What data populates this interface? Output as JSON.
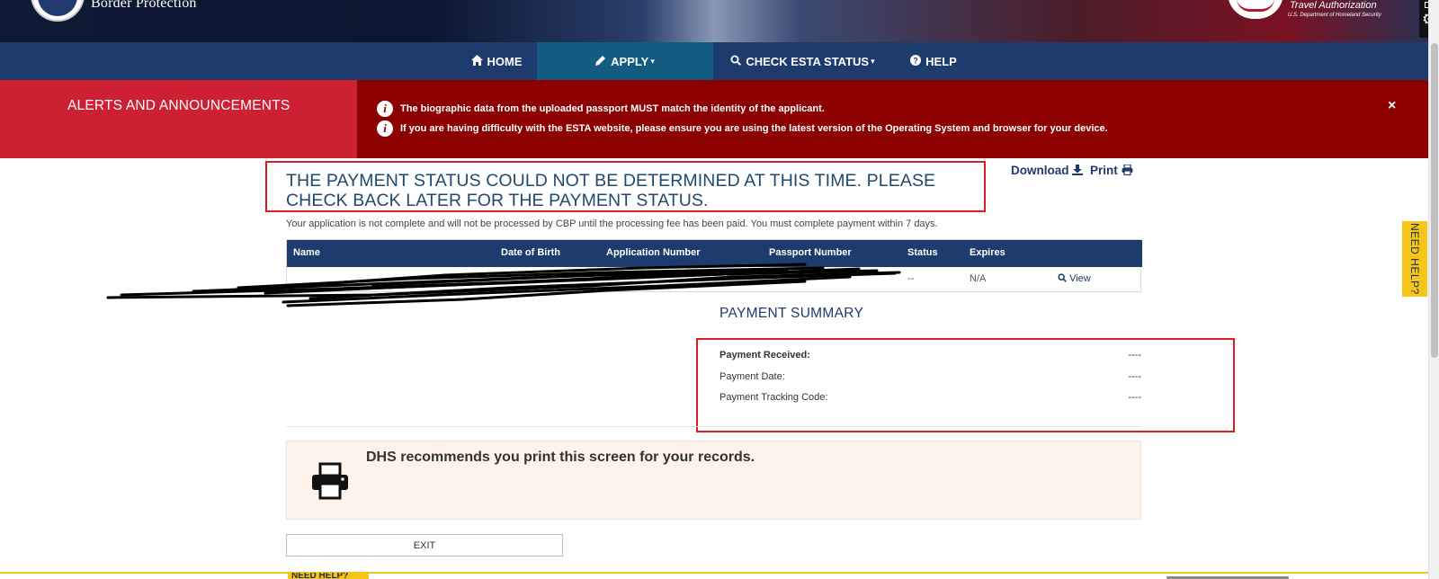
{
  "header": {
    "agency_name": "Border Protection",
    "esta_logo": {
      "tagline": "Travel Authorization",
      "subline": "U.S. Department of Homeland Security"
    }
  },
  "nav": {
    "items": [
      {
        "label": "HOME",
        "icon": "home-icon"
      },
      {
        "label": "APPLY",
        "icon": "pencil-icon",
        "caret": "▾",
        "active": true
      },
      {
        "label": "CHECK ESTA STATUS",
        "icon": "search-icon",
        "caret": "▾"
      },
      {
        "label": "HELP",
        "icon": "question-circle-icon"
      }
    ]
  },
  "alerts": {
    "title": "ALERTS AND ANNOUNCEMENTS",
    "messages": [
      "The biographic data from the uploaded passport MUST match the identity of the applicant.",
      "If you are having difficulty with the ESTA website, please ensure you are using the latest version of the Operating System and browser for your device."
    ],
    "close": "×"
  },
  "main": {
    "status_heading": "THE PAYMENT STATUS COULD NOT BE DETERMINED AT THIS TIME. PLEASE CHECK BACK LATER FOR THE PAYMENT STATUS.",
    "download_label": "Download",
    "print_label": "Print",
    "note": "Your application is not complete and will not be processed by CBP until the processing fee has been paid. You must complete payment within 7 days.",
    "table": {
      "headers": [
        "Name",
        "Date of Birth",
        "Application Number",
        "Passport Number",
        "Status",
        "Expires"
      ],
      "row": {
        "status": "--",
        "expires": "N/A",
        "action": "View"
      }
    },
    "payment_summary": {
      "title": "PAYMENT SUMMARY",
      "rows": [
        {
          "label": "Payment Received:",
          "value": "----"
        },
        {
          "label": "Payment Date:",
          "value": "----"
        },
        {
          "label": "Payment Tracking Code:",
          "value": "----"
        }
      ]
    },
    "recommendation": "DHS recommends you print this screen for your records.",
    "exit_label": "EXIT"
  },
  "help": {
    "side_label": "NEED HELP?",
    "bottom_label": "NEED HELP?"
  },
  "colors": {
    "nav_bg": "#1e3b6e",
    "nav_active": "#145b82",
    "alert_dark": "#8c0000",
    "alert_light": "#cd2033",
    "heading_text": "#1f4a6e",
    "highlight_border": "#e01b24",
    "help_tab": "#f5c518",
    "recommend_bg": "#fdf3ea"
  }
}
